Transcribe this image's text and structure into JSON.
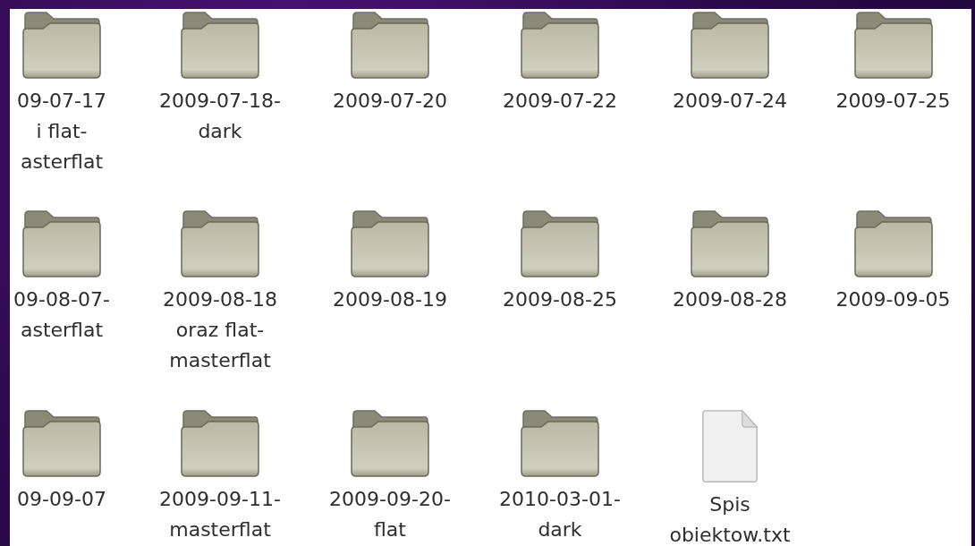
{
  "items": [
    {
      "kind": "folder",
      "lines": [
        "09-07-17",
        "i flat-",
        "asterflat"
      ]
    },
    {
      "kind": "folder",
      "lines": [
        "2009-07-18-",
        "dark"
      ]
    },
    {
      "kind": "folder",
      "lines": [
        "2009-07-20"
      ]
    },
    {
      "kind": "folder",
      "lines": [
        "2009-07-22"
      ]
    },
    {
      "kind": "folder",
      "lines": [
        "2009-07-24"
      ]
    },
    {
      "kind": "folder",
      "lines": [
        "2009-07-25"
      ]
    },
    {
      "kind": "folder",
      "lines": [
        "09-08-07-",
        "asterflat"
      ]
    },
    {
      "kind": "folder",
      "lines": [
        "2009-08-18",
        "oraz flat-",
        "masterflat"
      ]
    },
    {
      "kind": "folder",
      "lines": [
        "2009-08-19"
      ]
    },
    {
      "kind": "folder",
      "lines": [
        "2009-08-25"
      ]
    },
    {
      "kind": "folder",
      "lines": [
        "2009-08-28"
      ]
    },
    {
      "kind": "folder",
      "lines": [
        "2009-09-05"
      ]
    },
    {
      "kind": "folder",
      "lines": [
        "09-09-07"
      ]
    },
    {
      "kind": "folder",
      "lines": [
        "2009-09-11-",
        "masterflat"
      ]
    },
    {
      "kind": "folder",
      "lines": [
        "2009-09-20-",
        "flat"
      ]
    },
    {
      "kind": "folder",
      "lines": [
        "2010-03-01-",
        "dark"
      ]
    },
    {
      "kind": "file",
      "lines": [
        "Spis",
        "obiektow.txt"
      ]
    }
  ]
}
